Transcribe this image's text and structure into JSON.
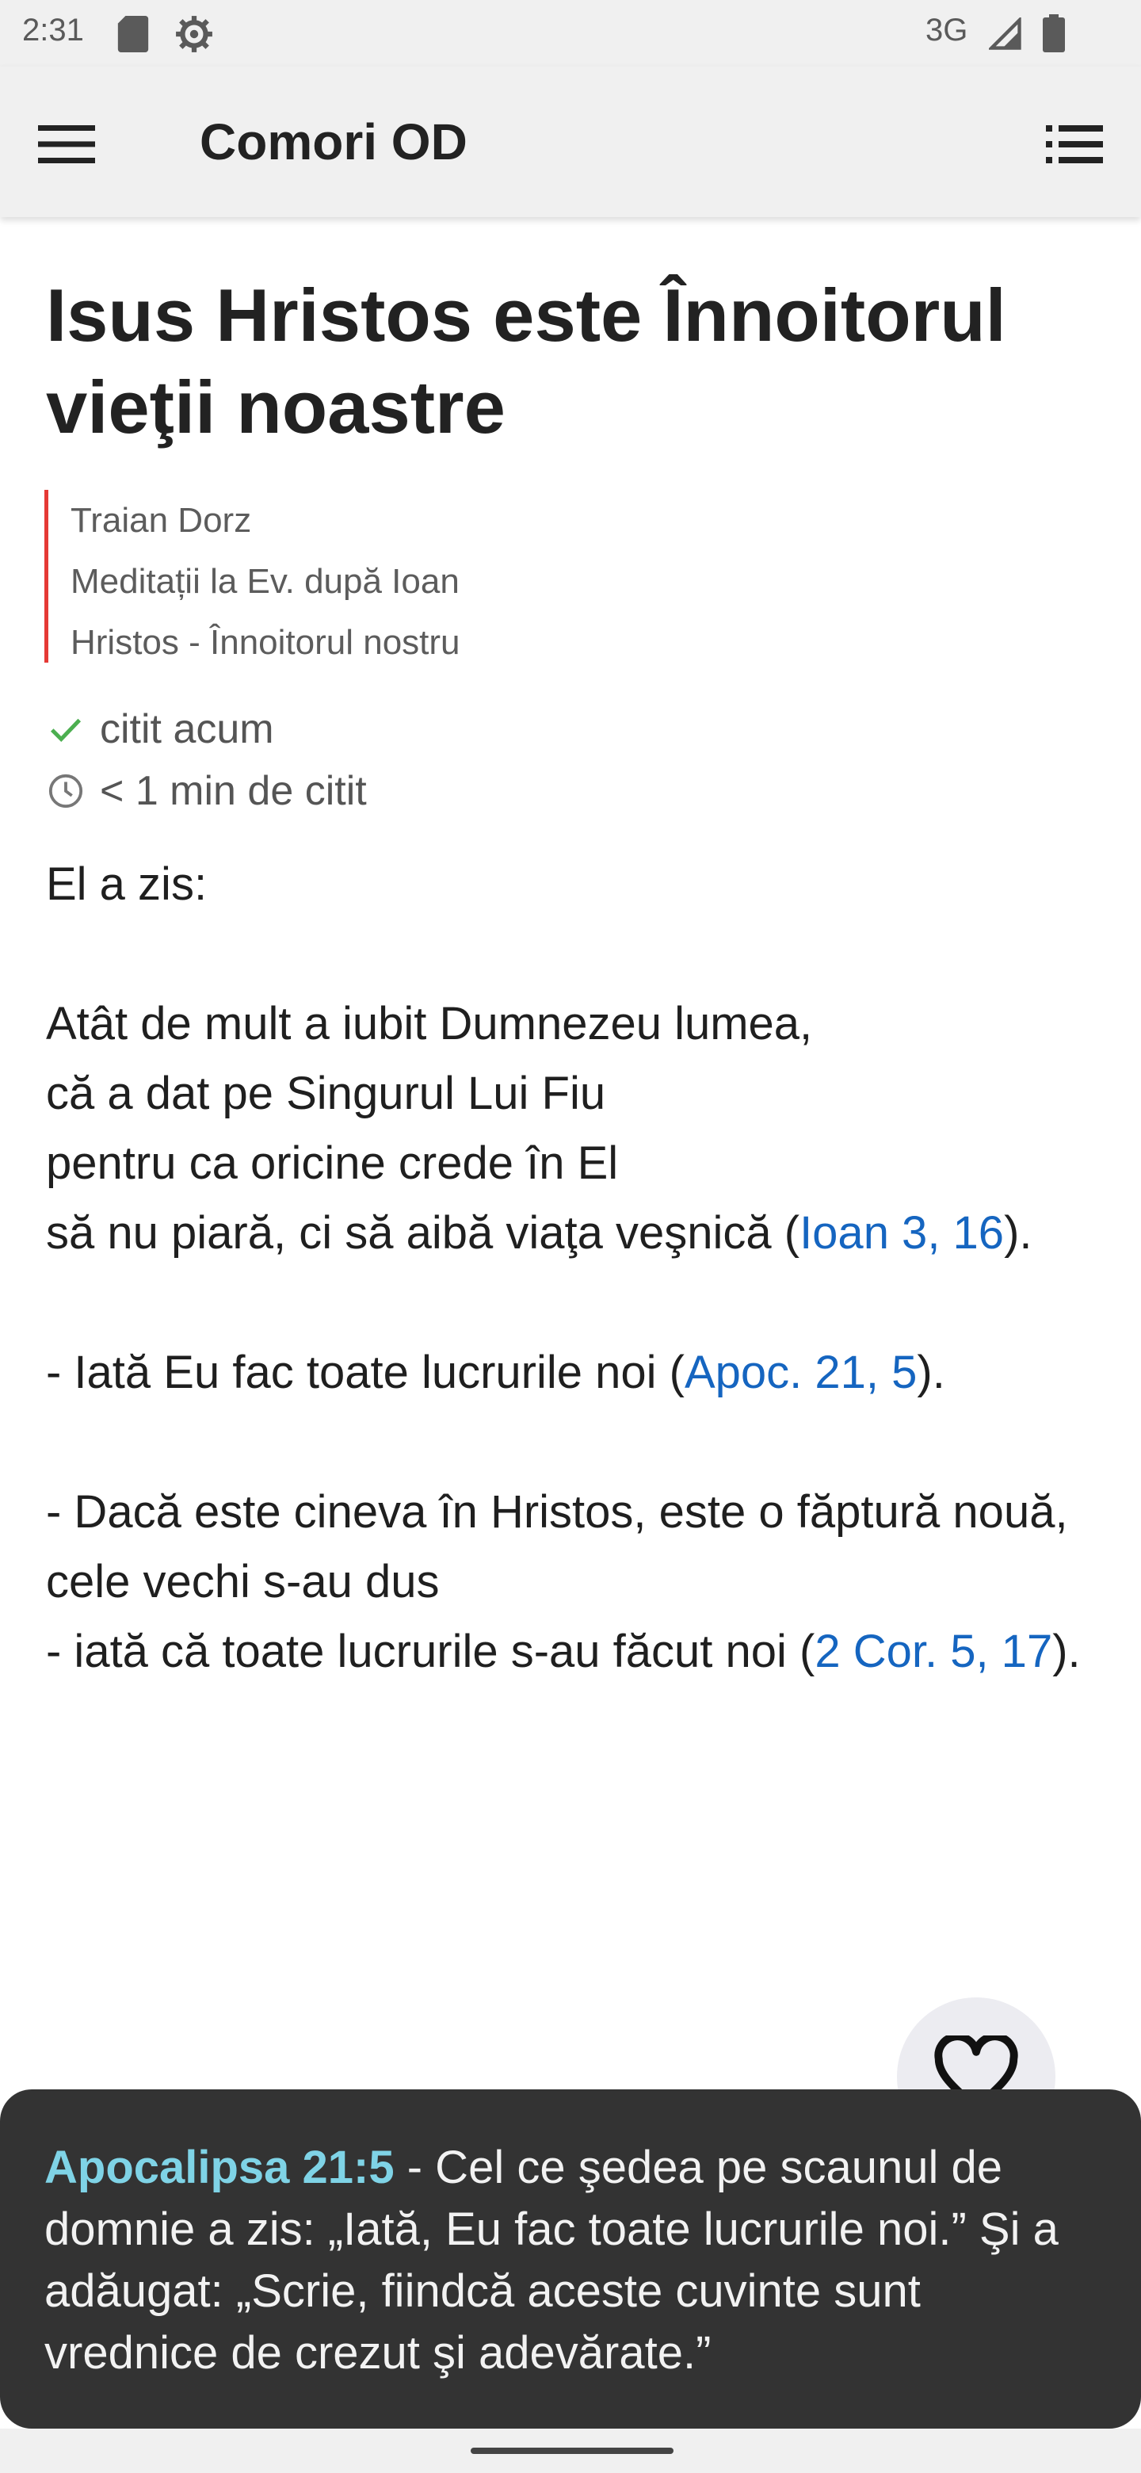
{
  "status_bar": {
    "time": "2:31",
    "network": "3G",
    "icons": [
      "sd-card-icon",
      "gear-icon",
      "signal-icon",
      "battery-icon"
    ]
  },
  "app_bar": {
    "title": "Comori OD",
    "menu_icon": "hamburger-menu-icon",
    "toc_icon": "list-icon"
  },
  "article": {
    "title": "Isus Hristos este Înnoitorul vieţii noastre",
    "author": "Traian Dorz",
    "book": "Meditații la Ev. după Ioan",
    "chapter": "Hristos - Înnoitorul nostru",
    "read_status": "citit acum",
    "read_time": "< 1 min de citit"
  },
  "body": {
    "intro": "El a zis:",
    "p1_l1": "Atât de mult a iubit Dumnezeu lumea,",
    "p1_l2": "că a dat pe Singurul Lui Fiu",
    "p1_l3": "pentru ca oricine crede în El",
    "p1_l4_text": "să nu piară, ci să aibă viaţa veşnică (",
    "p1_ref": "Ioan 3, 16",
    "p1_close": ").",
    "p2_text": "- Iată Eu fac toate lucrurile noi (",
    "p2_ref": "Apoc. 21, 5",
    "p2_close": ").",
    "p3_l1": "- Dacă este cineva în Hristos, este o făptură nouă,",
    "p3_l2": "cele vechi s-au dus",
    "p3_l3_text": "- iată că toate lucrurile s-au făcut noi (",
    "p3_ref": "2 Cor. 5, 17",
    "p3_close": ")."
  },
  "verse_popup": {
    "reference": "Apocalipsa 21:5",
    "text": " - Cel ce şedea pe scaunul de domnie a zis: „Iată, Eu fac toate lucrurile noi.” Şi a adăugat: „Scrie, fiindcă aceste cuvinte sunt vrednice de crezut şi adevărate.”"
  },
  "colors": {
    "accent_red": "#e53935",
    "link_blue": "#1565c0",
    "popup_ref": "#7fd3e6",
    "check_green": "#4caf50"
  }
}
